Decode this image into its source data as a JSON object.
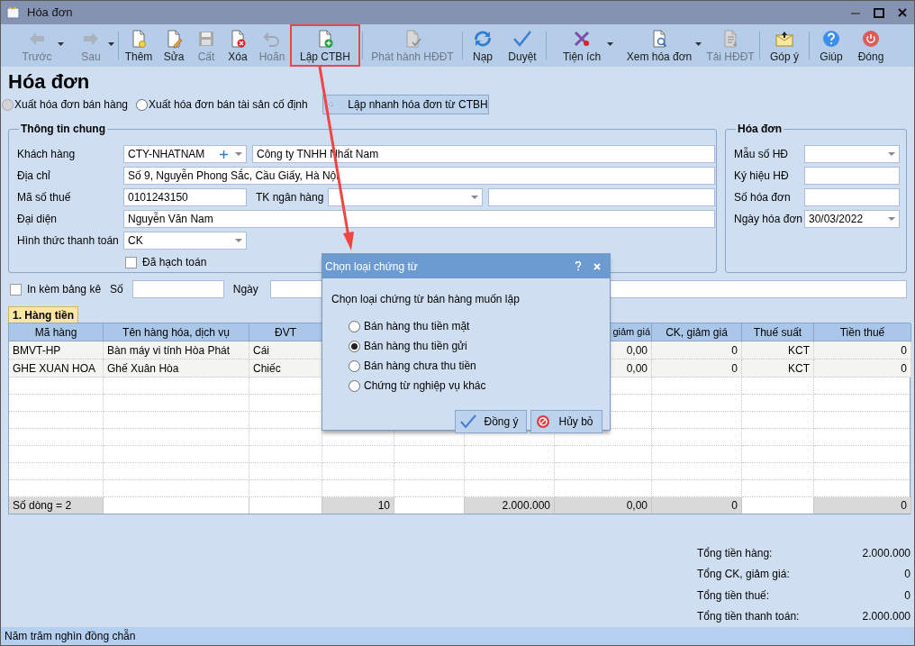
{
  "window": {
    "title": "Hóa đơn"
  },
  "toolbar": [
    {
      "label": "Trước",
      "disabled": true,
      "dropdown": true,
      "highlighted": false
    },
    {
      "label": "Sau",
      "disabled": true,
      "dropdown": true,
      "highlighted": false
    },
    {
      "label": "Thêm",
      "disabled": false,
      "dropdown": false,
      "highlighted": false
    },
    {
      "label": "Sửa",
      "disabled": false,
      "dropdown": false,
      "highlighted": false
    },
    {
      "label": "Cất",
      "disabled": true,
      "dropdown": false,
      "highlighted": false
    },
    {
      "label": "Xóa",
      "disabled": false,
      "dropdown": false,
      "highlighted": false
    },
    {
      "label": "Hoãn",
      "disabled": true,
      "dropdown": false,
      "highlighted": false
    },
    {
      "label": "Lập CTBH",
      "disabled": false,
      "dropdown": false,
      "highlighted": true
    },
    {
      "label": "Phát hành HĐĐT",
      "disabled": true,
      "dropdown": false,
      "highlighted": false
    },
    {
      "label": "Nạp",
      "disabled": false,
      "dropdown": false,
      "highlighted": false
    },
    {
      "label": "Duyệt",
      "disabled": false,
      "dropdown": false,
      "highlighted": false
    },
    {
      "label": "Tiện ích",
      "disabled": false,
      "dropdown": true,
      "highlighted": false
    },
    {
      "label": "Xem hóa đơn",
      "disabled": false,
      "dropdown": true,
      "highlighted": false
    },
    {
      "label": "Tải HĐĐT",
      "disabled": true,
      "dropdown": false,
      "highlighted": false
    },
    {
      "label": "Góp ý",
      "disabled": false,
      "dropdown": false,
      "highlighted": false
    },
    {
      "label": "Giúp",
      "disabled": false,
      "dropdown": false,
      "highlighted": false
    },
    {
      "label": "Đóng",
      "disabled": false,
      "dropdown": false,
      "highlighted": false
    }
  ],
  "page_title": "Hóa đơn",
  "invoice_options": [
    {
      "label": "Xuất hóa đơn bán hàng",
      "selected": false,
      "disabled": true
    },
    {
      "label": "Xuất hóa đơn bán tài sản cố định",
      "selected": false,
      "disabled": false
    }
  ],
  "quick_button": "Lập nhanh hóa đơn từ CTBH",
  "general_info": {
    "title": "Thông tin chung",
    "customer": {
      "label": "Khách hàng",
      "code": "CTY-NHATNAM",
      "name": "Công ty TNHH Nhất Nam"
    },
    "address": {
      "label": "Địa chỉ",
      "value": "Số 9, Nguyễn Phong Sắc, Cầu Giấy, Hà Nội"
    },
    "tax_code": {
      "label": "Mã số thuế",
      "value": "0101243150"
    },
    "bank_account": {
      "label": "TK ngân hàng"
    },
    "representative": {
      "label": "Đại diện",
      "value": "Nguyễn Văn Nam"
    },
    "payment_method": {
      "label": "Hình thức thanh toán",
      "value": "CK"
    },
    "posted": {
      "label": "Đã hạch toán",
      "checked": false
    }
  },
  "invoice": {
    "title": "Hóa đơn",
    "fields": [
      {
        "label": "Mẫu số HĐ",
        "kind": "combo"
      },
      {
        "label": "Ký hiệu HĐ",
        "kind": "text"
      },
      {
        "label": "Số hóa đơn",
        "kind": "text"
      },
      {
        "label": "Ngày hóa đơn",
        "kind": "combo",
        "value": "30/03/2022"
      }
    ]
  },
  "attach": {
    "label": "In kèm bảng kê",
    "checked": false,
    "number_label": "Số",
    "date_label": "Ngày"
  },
  "tabs": [
    {
      "label": "1. Hàng tiền",
      "selected": true
    }
  ],
  "table": {
    "columns": [
      "Mã hàng",
      "Tên hàng hóa, dịch vụ",
      "ĐVT",
      "giảm giá",
      "CK, giảm giá",
      "Thuế suất",
      "Tiền thuế"
    ],
    "rows": [
      {
        "cells": [
          "BMVT-HP",
          "Bàn máy vi tính Hòa Phát",
          "Cái",
          "0,00",
          "0",
          "KCT",
          "0"
        ]
      },
      {
        "cells": [
          "GHE XUAN HOA",
          "Ghế Xuân Hòa",
          "Chiếc",
          "0,00",
          "0",
          "KCT",
          "0"
        ]
      }
    ],
    "footer": [
      "Số dòng = 2",
      "10",
      "2.000.000",
      "0,00",
      "0",
      "0"
    ]
  },
  "totals": [
    {
      "label": "Tổng tiền hàng:",
      "value": "2.000.000"
    },
    {
      "label": "Tổng CK, giảm giá:",
      "value": "0"
    },
    {
      "label": "Tổng tiền thuế:",
      "value": "0"
    },
    {
      "label": "Tổng tiền thanh toán:",
      "value": "2.000.000"
    }
  ],
  "status_bar": "Năm trăm nghìn đồng chẵn",
  "dialog": {
    "title": "Chọn loại chứng từ",
    "prompt": "Chọn loại chứng từ bán hàng muốn lập",
    "options": [
      {
        "label": "Bán hàng thu tiền mặt",
        "selected": false
      },
      {
        "label": "Bán hàng thu tiền gửi",
        "selected": true
      },
      {
        "label": "Bán hàng chưa thu tiền",
        "selected": false
      },
      {
        "label": "Chứng từ nghiệp vụ khác",
        "selected": false
      }
    ],
    "buttons": [
      "Đồng ý",
      "Hủy bỏ"
    ]
  }
}
